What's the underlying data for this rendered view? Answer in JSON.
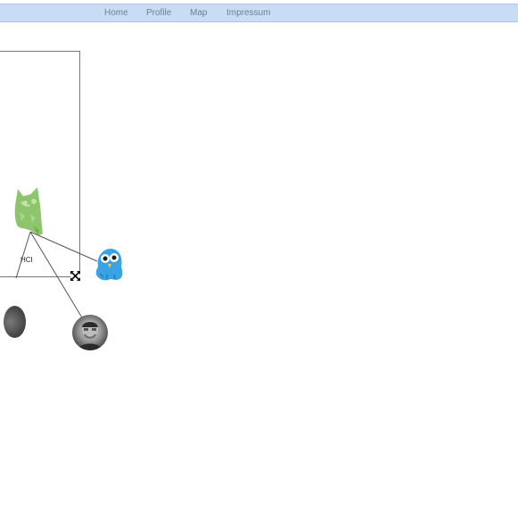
{
  "nav": {
    "items": [
      {
        "label": "Home"
      },
      {
        "label": "Profile"
      },
      {
        "label": "Map"
      },
      {
        "label": "Impressum"
      }
    ]
  },
  "map": {
    "cluster_label": "HCI",
    "nodes": [
      {
        "name": "owl",
        "icon": "green-owl-icon"
      },
      {
        "name": "bird",
        "icon": "blue-bird-icon"
      },
      {
        "name": "person",
        "icon": "person-avatar"
      },
      {
        "name": "partial",
        "icon": "partial-avatar"
      }
    ]
  },
  "colors": {
    "navbar": "#c8dcf4",
    "nav_text": "#6e7f96",
    "owl": "#8cc56b",
    "bird": "#3aa3e3"
  }
}
